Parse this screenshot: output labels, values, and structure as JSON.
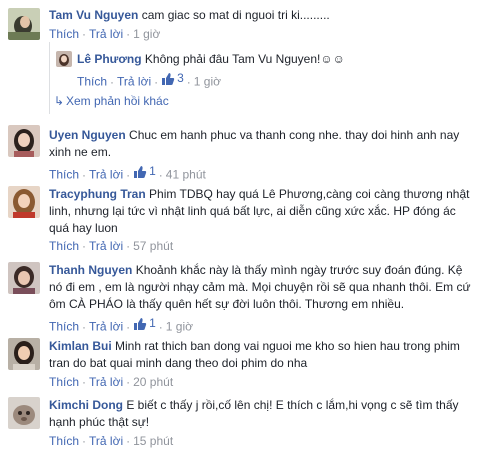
{
  "actions": {
    "like": "Thích",
    "reply": "Trả lời"
  },
  "comments": [
    {
      "author": "Tam Vu Nguyen",
      "text": "cam giac so mat di nguoi tri ki.........",
      "time": "1 giờ",
      "reply": {
        "author": "Lê Phương",
        "text": "Không phải đâu Tam Vu Nguyen!☺☺",
        "likes": "3",
        "time": "1 giờ"
      },
      "more_replies": "Xem phản hồi khác"
    },
    {
      "author": "Uyen Nguyen",
      "text": "Chuc em hanh phuc va thanh cong nhe. thay doi hinh anh nay xinh ne em.",
      "likes": "1",
      "time": "41 phút"
    },
    {
      "author": "Tracyphung Tran",
      "text": "Phim TDBQ hay quá Lê Phương,càng coi càng thương nhật linh, nhưng lại tức vì nhật linh quá bất lực, ai diễn cũng xức xắc. HP đóng ác quá hay luon",
      "time": "57 phút"
    },
    {
      "author": "Thanh Nguyen",
      "text": "Khoảnh khắc này là thấy mình ngày trước suy đoán đúng. Kệ nó đi em , em là người nhạy cảm mà. Mọi chuyện rồi sẽ qua nhanh thôi. Em cứ ôm CÀ PHÁO là thấy quên hết sự đời luôn thôi. Thương em nhiều.",
      "likes": "1",
      "time": "1 giờ"
    },
    {
      "author": "Kimlan Bui",
      "text": "Minh rat thich ban dong vai nguoi me kho so hien hau trong phim tran do bat quai minh dang theo doi phim do nha",
      "time": "20 phút"
    },
    {
      "author": "Kimchi Dong",
      "text": "E biết c thấy j rồi,cố lên chị! E thích c lắm,hi vọng c sẽ tìm thấy hạnh phúc thật sự!",
      "time": "15 phút"
    }
  ],
  "colors": {
    "link": "#365899",
    "action": "#4267b2",
    "muted": "#90949c",
    "text": "#1d2129"
  }
}
